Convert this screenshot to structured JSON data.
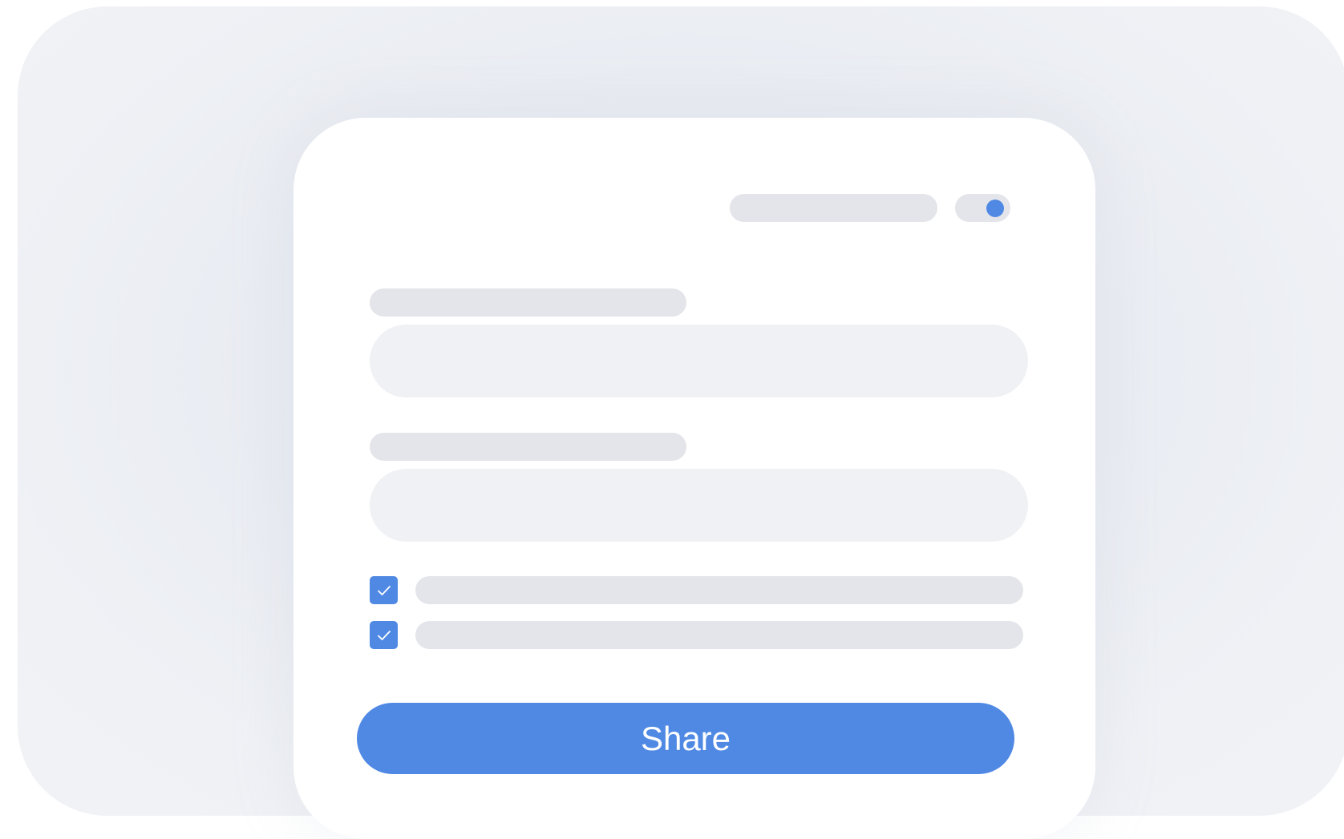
{
  "colors": {
    "accent": "#4f89e4",
    "placeholder": "#e4e5ea",
    "field": "#f0f1f5",
    "card": "#ffffff"
  },
  "header": {
    "toggle": {
      "state": "on",
      "icon": "toggle-switch-icon"
    }
  },
  "form": {
    "fields": [
      {
        "label": "",
        "value": ""
      },
      {
        "label": "",
        "value": ""
      }
    ],
    "checkboxes": [
      {
        "checked": true,
        "icon": "checkmark-icon",
        "label": ""
      },
      {
        "checked": true,
        "icon": "checkmark-icon",
        "label": ""
      }
    ],
    "submit_label": "Share"
  }
}
